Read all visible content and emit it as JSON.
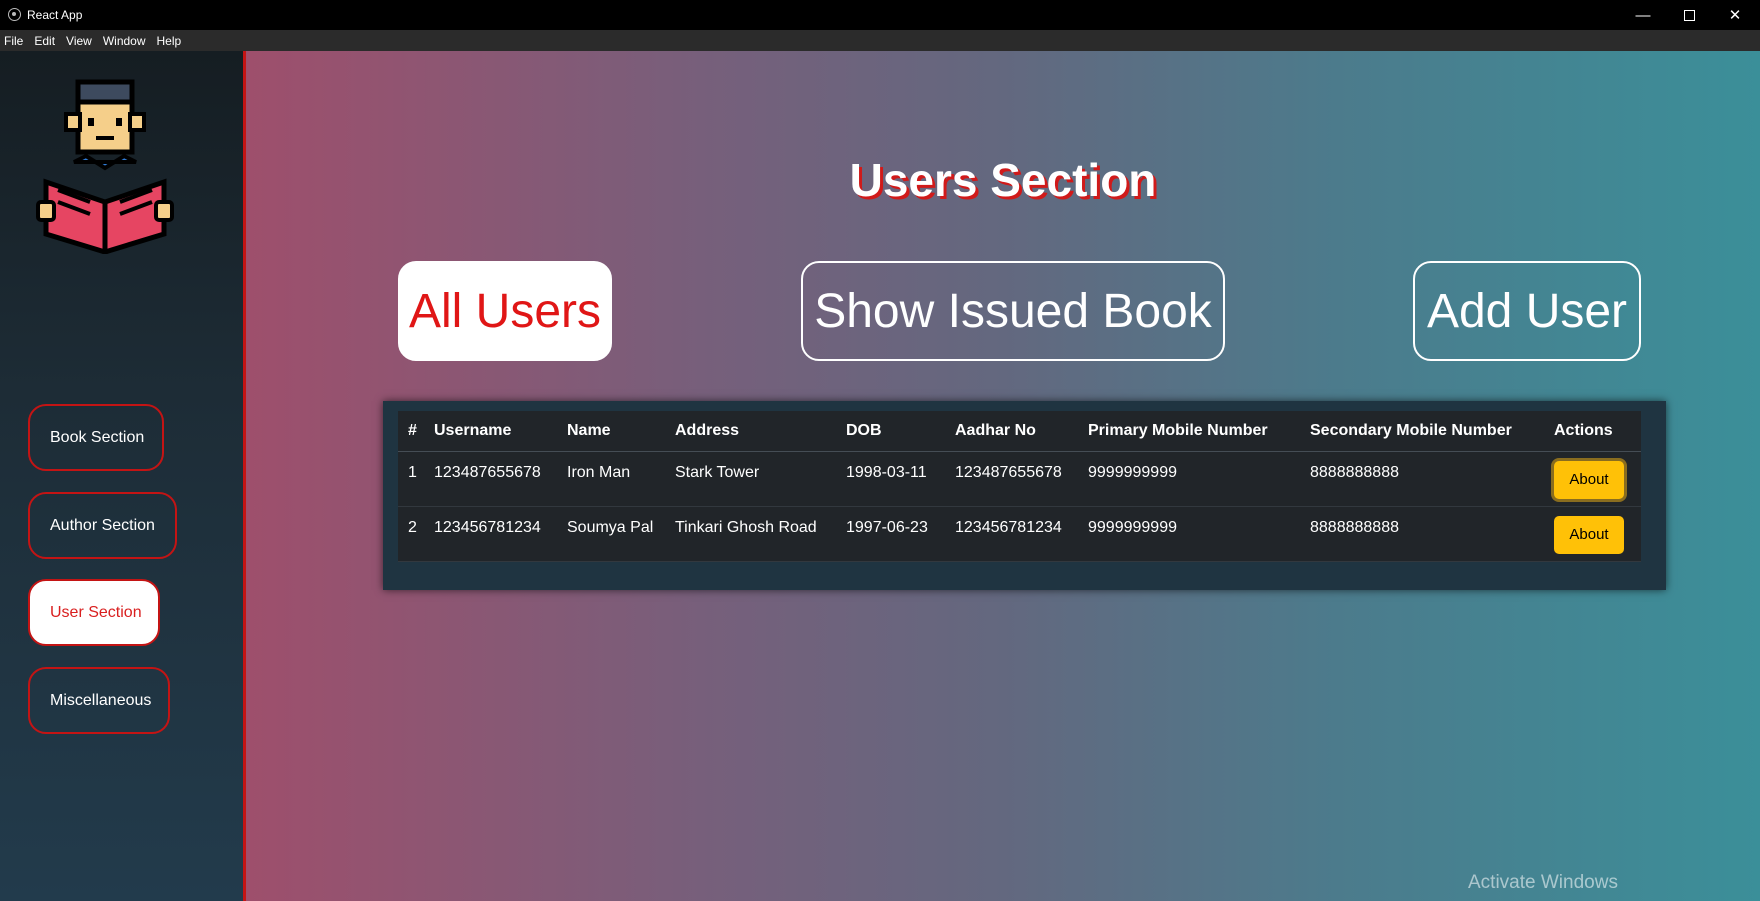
{
  "window": {
    "title": "React App",
    "min_glyph": "—",
    "close_glyph": "✕"
  },
  "menu": [
    "File",
    "Edit",
    "View",
    "Window",
    "Help"
  ],
  "sidebar": {
    "items": [
      {
        "label": "Book Section",
        "active": false
      },
      {
        "label": "Author Section",
        "active": false
      },
      {
        "label": "User Section",
        "active": true
      },
      {
        "label": "Miscellaneous",
        "active": false
      }
    ]
  },
  "main": {
    "title": "Users Section",
    "actions": {
      "all_users": "All Users",
      "show_issued": "Show Issued Book",
      "add_user": "Add User"
    },
    "table": {
      "headers": [
        "#",
        "Username",
        "Name",
        "Address",
        "DOB",
        "Aadhar No",
        "Primary Mobile Number",
        "Secondary Mobile Number",
        "Actions"
      ],
      "rows": [
        [
          "1",
          "123487655678",
          "Iron Man",
          "Stark Tower",
          "1998-03-11",
          "123487655678",
          "9999999999",
          "8888888888",
          "About"
        ],
        [
          "2",
          "123456781234",
          "Soumya Pal",
          "Tinkari Ghosh Road",
          "1997-06-23",
          "123456781234",
          "9999999999",
          "8888888888",
          "About"
        ]
      ]
    }
  },
  "watermark": "Activate Windows",
  "colors": {
    "accent_red": "#c41414",
    "button_yellow": "#ffc107",
    "table_bg": "#212529"
  }
}
